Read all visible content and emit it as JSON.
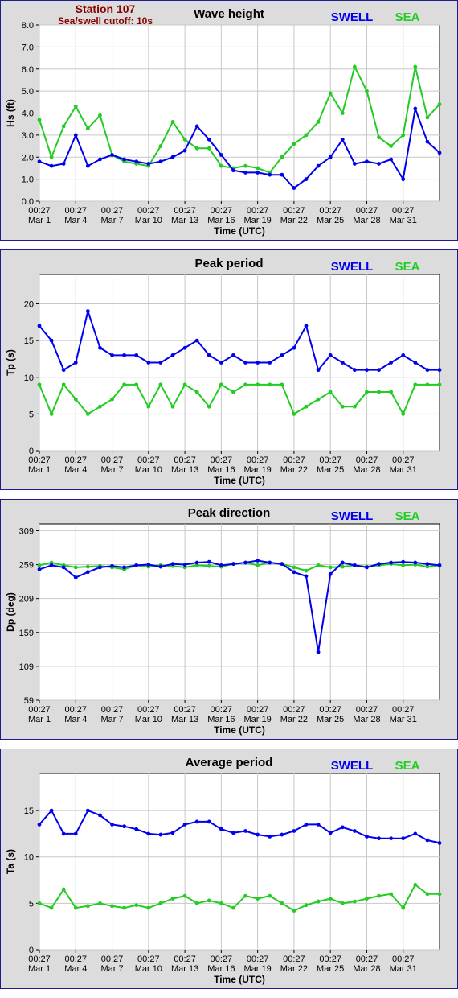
{
  "station": {
    "name": "Station 107",
    "cutoff": "Sea/swell cutoff: 10s"
  },
  "legend": {
    "swell": "SWELL",
    "sea": "SEA",
    "swell_color": "#0000ee",
    "sea_color": "#22cc22"
  },
  "x_axis": {
    "label": "Time (UTC)",
    "range_days": [
      0,
      33
    ],
    "ticks": [
      {
        "day": 0,
        "time": "00:27",
        "date": "Mar 1"
      },
      {
        "day": 3,
        "time": "00:27",
        "date": "Mar 4"
      },
      {
        "day": 6,
        "time": "00:27",
        "date": "Mar 7"
      },
      {
        "day": 9,
        "time": "00:27",
        "date": "Mar 10"
      },
      {
        "day": 12,
        "time": "00:27",
        "date": "Mar 13"
      },
      {
        "day": 15,
        "time": "00:27",
        "date": "Mar 16"
      },
      {
        "day": 18,
        "time": "00:27",
        "date": "Mar 19"
      },
      {
        "day": 21,
        "time": "00:27",
        "date": "Mar 22"
      },
      {
        "day": 24,
        "time": "00:27",
        "date": "Mar 25"
      },
      {
        "day": 27,
        "time": "00:27",
        "date": "Mar 28"
      },
      {
        "day": 30,
        "time": "00:27",
        "date": "Mar 31"
      }
    ]
  },
  "chart_data": [
    {
      "type": "line",
      "title": "Wave height",
      "ylabel": "Hs (ft)",
      "ylim": [
        0,
        8
      ],
      "yticks": [
        "0.0",
        "1.0",
        "2.0",
        "3.0",
        "4.0",
        "5.0",
        "6.0",
        "7.0",
        "8.0"
      ],
      "grid": true,
      "legend": "top-right",
      "series": [
        {
          "name": "SWELL",
          "x": [
            0,
            1,
            2,
            3,
            4,
            5,
            6,
            7,
            8,
            9,
            10,
            11,
            12,
            13,
            14,
            15,
            16,
            17,
            18,
            19,
            20,
            21,
            22,
            23,
            24,
            25,
            26,
            27,
            28,
            29,
            30,
            31,
            32,
            33
          ],
          "values": [
            1.8,
            1.6,
            1.7,
            3.0,
            1.6,
            1.9,
            2.1,
            1.9,
            1.8,
            1.7,
            1.8,
            2.0,
            2.3,
            3.4,
            2.8,
            2.1,
            1.4,
            1.3,
            1.3,
            1.2,
            1.2,
            0.6,
            1.0,
            1.6,
            2.0,
            2.8,
            1.7,
            1.8,
            1.7,
            1.9,
            1.0,
            4.2,
            2.7,
            2.2
          ]
        },
        {
          "name": "SEA",
          "x": [
            0,
            1,
            2,
            3,
            4,
            5,
            6,
            7,
            8,
            9,
            10,
            11,
            12,
            13,
            14,
            15,
            16,
            17,
            18,
            19,
            20,
            21,
            22,
            23,
            24,
            25,
            26,
            27,
            28,
            29,
            30,
            31,
            32,
            33
          ],
          "values": [
            3.7,
            2.0,
            3.4,
            4.3,
            3.3,
            3.9,
            2.1,
            1.8,
            1.7,
            1.6,
            2.5,
            3.6,
            2.8,
            2.4,
            2.4,
            1.6,
            1.5,
            1.6,
            1.5,
            1.3,
            2.0,
            2.6,
            3.0,
            3.6,
            4.9,
            4.0,
            6.1,
            5.0,
            2.9,
            2.5,
            3.0,
            6.1,
            3.8,
            4.4
          ]
        }
      ]
    },
    {
      "type": "line",
      "title": "Peak period",
      "ylabel": "Tp (s)",
      "ylim": [
        0,
        24
      ],
      "yticks": [
        "0",
        "5",
        "10",
        "15",
        "20"
      ],
      "grid": true,
      "legend": "top-right",
      "series": [
        {
          "name": "SWELL",
          "x": [
            0,
            1,
            2,
            3,
            4,
            5,
            6,
            7,
            8,
            9,
            10,
            11,
            12,
            13,
            14,
            15,
            16,
            17,
            18,
            19,
            20,
            21,
            22,
            23,
            24,
            25,
            26,
            27,
            28,
            29,
            30,
            31,
            32,
            33
          ],
          "values": [
            17,
            15,
            11,
            12,
            19,
            14,
            13,
            13,
            13,
            12,
            12,
            13,
            14,
            15,
            13,
            12,
            13,
            12,
            12,
            12,
            13,
            14,
            17,
            11,
            13,
            12,
            11,
            11,
            11,
            12,
            13,
            12,
            11,
            11
          ]
        },
        {
          "name": "SEA",
          "x": [
            0,
            1,
            2,
            3,
            4,
            5,
            6,
            7,
            8,
            9,
            10,
            11,
            12,
            13,
            14,
            15,
            16,
            17,
            18,
            19,
            20,
            21,
            22,
            23,
            24,
            25,
            26,
            27,
            28,
            29,
            30,
            31,
            32,
            33
          ],
          "values": [
            9,
            5,
            9,
            7,
            5,
            6,
            7,
            9,
            9,
            6,
            9,
            6,
            9,
            8,
            6,
            9,
            8,
            9,
            9,
            9,
            9,
            5,
            6,
            7,
            8,
            6,
            6,
            8,
            8,
            8,
            5,
            9,
            9,
            9
          ]
        }
      ]
    },
    {
      "type": "line",
      "title": "Peak direction",
      "ylabel": "Dp (deg)",
      "ylim": [
        59,
        319
      ],
      "yticks": [
        "59",
        "109",
        "159",
        "209",
        "259",
        "309"
      ],
      "grid": true,
      "legend": "top-right",
      "series": [
        {
          "name": "SWELL",
          "x": [
            0,
            1,
            2,
            3,
            4,
            5,
            6,
            7,
            8,
            9,
            10,
            11,
            12,
            13,
            14,
            15,
            16,
            17,
            18,
            19,
            20,
            21,
            22,
            23,
            24,
            25,
            26,
            27,
            28,
            29,
            30,
            31,
            32,
            33
          ],
          "values": [
            252,
            258,
            255,
            240,
            248,
            255,
            257,
            255,
            258,
            259,
            256,
            260,
            259,
            262,
            263,
            258,
            260,
            262,
            265,
            262,
            260,
            248,
            242,
            130,
            245,
            262,
            258,
            255,
            260,
            262,
            263,
            262,
            260,
            258
          ]
        },
        {
          "name": "SEA",
          "x": [
            0,
            1,
            2,
            3,
            4,
            5,
            6,
            7,
            8,
            9,
            10,
            11,
            12,
            13,
            14,
            15,
            16,
            17,
            18,
            19,
            20,
            21,
            22,
            23,
            24,
            25,
            26,
            27,
            28,
            29,
            30,
            31,
            32,
            33
          ],
          "values": [
            258,
            262,
            258,
            255,
            256,
            257,
            255,
            252,
            258,
            256,
            258,
            257,
            255,
            258,
            257,
            256,
            260,
            262,
            258,
            262,
            260,
            255,
            250,
            258,
            255,
            256,
            258,
            256,
            258,
            260,
            258,
            259,
            256,
            258
          ]
        }
      ]
    },
    {
      "type": "line",
      "title": "Average period",
      "ylabel": "Ta (s)",
      "ylim": [
        0,
        19
      ],
      "yticks": [
        "0",
        "5",
        "10",
        "15"
      ],
      "grid": true,
      "legend": "top-right",
      "series": [
        {
          "name": "SWELL",
          "x": [
            0,
            1,
            2,
            3,
            4,
            5,
            6,
            7,
            8,
            9,
            10,
            11,
            12,
            13,
            14,
            15,
            16,
            17,
            18,
            19,
            20,
            21,
            22,
            23,
            24,
            25,
            26,
            27,
            28,
            29,
            30,
            31,
            32,
            33
          ],
          "values": [
            13.5,
            15,
            12.5,
            12.5,
            15,
            14.5,
            13.5,
            13.3,
            13,
            12.5,
            12.4,
            12.6,
            13.5,
            13.8,
            13.8,
            13,
            12.6,
            12.8,
            12.4,
            12.2,
            12.4,
            12.8,
            13.5,
            13.5,
            12.6,
            13.2,
            12.8,
            12.2,
            12,
            12,
            12,
            12.5,
            11.8,
            11.5
          ]
        },
        {
          "name": "SEA",
          "x": [
            0,
            1,
            2,
            3,
            4,
            5,
            6,
            7,
            8,
            9,
            10,
            11,
            12,
            13,
            14,
            15,
            16,
            17,
            18,
            19,
            20,
            21,
            22,
            23,
            24,
            25,
            26,
            27,
            28,
            29,
            30,
            31,
            32,
            33
          ],
          "values": [
            5,
            4.5,
            6.5,
            4.5,
            4.7,
            5.0,
            4.7,
            4.5,
            4.8,
            4.5,
            5.0,
            5.5,
            5.8,
            5.0,
            5.3,
            5.0,
            4.5,
            5.8,
            5.5,
            5.8,
            5.0,
            4.2,
            4.8,
            5.2,
            5.5,
            5.0,
            5.2,
            5.5,
            5.8,
            6.0,
            4.5,
            7.0,
            6.0,
            6.0
          ]
        }
      ]
    }
  ]
}
